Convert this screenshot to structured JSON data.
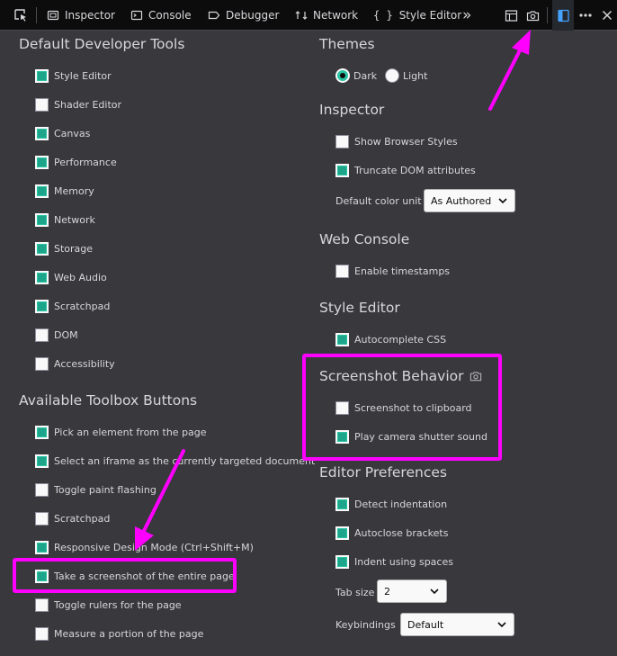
{
  "toolbar": {
    "tabs": [
      {
        "label": "Inspector"
      },
      {
        "label": "Console"
      },
      {
        "label": "Debugger"
      },
      {
        "label": "Network"
      },
      {
        "label": "Style Editor"
      }
    ],
    "overflow": "»"
  },
  "default_tools": {
    "title": "Default Developer Tools",
    "items": [
      {
        "label": "Style Editor",
        "checked": true
      },
      {
        "label": "Shader Editor",
        "checked": false
      },
      {
        "label": "Canvas",
        "checked": true
      },
      {
        "label": "Performance",
        "checked": true
      },
      {
        "label": "Memory",
        "checked": true
      },
      {
        "label": "Network",
        "checked": true
      },
      {
        "label": "Storage",
        "checked": true
      },
      {
        "label": "Web Audio",
        "checked": true
      },
      {
        "label": "Scratchpad",
        "checked": true
      },
      {
        "label": "DOM",
        "checked": false
      },
      {
        "label": "Accessibility",
        "checked": false
      }
    ]
  },
  "toolbox_buttons": {
    "title": "Available Toolbox Buttons",
    "items": [
      {
        "label": "Pick an element from the page",
        "checked": true
      },
      {
        "label": "Select an iframe as the currently targeted document",
        "checked": true
      },
      {
        "label": "Toggle paint flashing",
        "checked": false
      },
      {
        "label": "Scratchpad",
        "checked": false
      },
      {
        "label": "Responsive Design Mode (Ctrl+Shift+M)",
        "checked": true
      },
      {
        "label": "Take a screenshot of the entire page",
        "checked": true
      },
      {
        "label": "Toggle rulers for the page",
        "checked": false
      },
      {
        "label": "Measure a portion of the page",
        "checked": false
      }
    ]
  },
  "themes": {
    "title": "Themes",
    "options": [
      {
        "label": "Dark",
        "selected": true
      },
      {
        "label": "Light",
        "selected": false
      }
    ]
  },
  "inspector": {
    "title": "Inspector",
    "items": [
      {
        "label": "Show Browser Styles",
        "checked": false
      },
      {
        "label": "Truncate DOM attributes",
        "checked": true
      }
    ],
    "color_unit_label": "Default color unit",
    "color_unit_value": "As Authored"
  },
  "web_console": {
    "title": "Web Console",
    "items": [
      {
        "label": "Enable timestamps",
        "checked": false
      }
    ]
  },
  "style_editor": {
    "title": "Style Editor",
    "items": [
      {
        "label": "Autocomplete CSS",
        "checked": true
      }
    ]
  },
  "screenshot": {
    "title": "Screenshot Behavior",
    "items": [
      {
        "label": "Screenshot to clipboard",
        "checked": false
      },
      {
        "label": "Play camera shutter sound",
        "checked": true
      }
    ]
  },
  "editor": {
    "title": "Editor Preferences",
    "items": [
      {
        "label": "Detect indentation",
        "checked": true
      },
      {
        "label": "Autoclose brackets",
        "checked": true
      },
      {
        "label": "Indent using spaces",
        "checked": true
      }
    ],
    "tab_size_label": "Tab size",
    "tab_size_value": "2",
    "keybindings_label": "Keybindings",
    "keybindings_value": "Default"
  },
  "colors": {
    "background": "#38383d",
    "toolbar": "#0c0c0d",
    "checked": "#2ac3a2",
    "highlight": "#ff00ff"
  }
}
